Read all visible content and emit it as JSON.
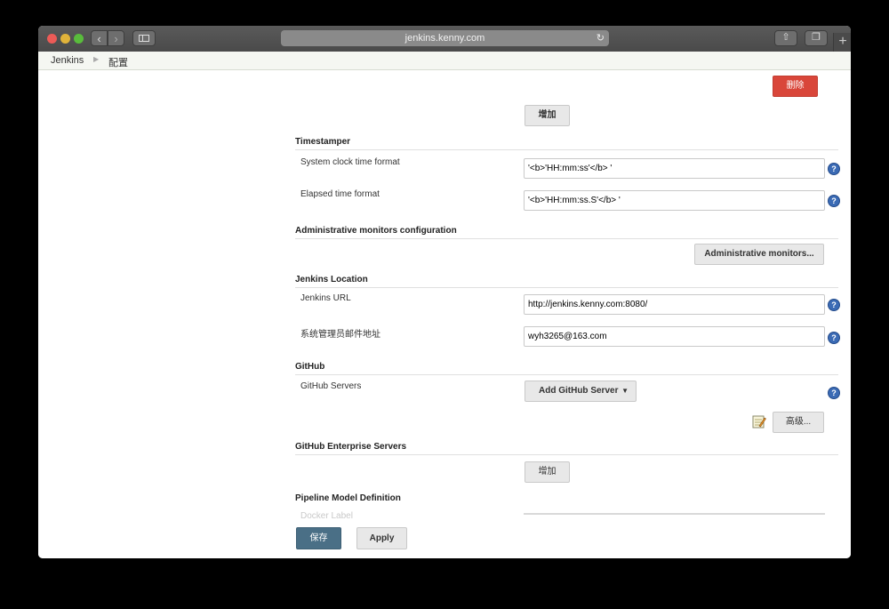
{
  "browser": {
    "url": "jenkins.kenny.com",
    "reload_icon": "reload-icon",
    "back_icon": "chevron-left-icon",
    "forward_icon": "chevron-right-icon",
    "sidebar_icon": "sidebar-icon",
    "share_icon": "share-icon",
    "tabs_icon": "tabs-icon",
    "newtab_label": "+"
  },
  "breadcrumb": {
    "items": [
      "Jenkins",
      "配置"
    ]
  },
  "buttons": {
    "delete": "删除",
    "add": "增加",
    "admin_monitors": "Administrative monitors...",
    "add_github_server": "Add GitHub Server",
    "advanced": "高级...",
    "add_enterprise": "增加",
    "save": "保存",
    "apply": "Apply"
  },
  "sections": {
    "timestamper": {
      "title": "Timestamper",
      "system_clock_label": "System clock time format",
      "system_clock_value": "'<b>'HH:mm:ss'</b> '",
      "elapsed_label": "Elapsed time format",
      "elapsed_value": "'<b>'HH:mm:ss.S'</b> '"
    },
    "admin_monitors": {
      "title": "Administrative monitors configuration"
    },
    "jenkins_location": {
      "title": "Jenkins Location",
      "url_label": "Jenkins URL",
      "url_value": "http://jenkins.kenny.com:8080/",
      "email_label": "系统管理员邮件地址",
      "email_value": "wyh3265@163.com"
    },
    "github": {
      "title": "GitHub",
      "servers_label": "GitHub Servers"
    },
    "github_enterprise": {
      "title": "GitHub Enterprise Servers"
    },
    "pipeline": {
      "title": "Pipeline Model Definition",
      "partial_label": "Docker Label"
    }
  },
  "help_glyph": "?",
  "colors": {
    "delete_button": "#d9463a",
    "save_button": "#4a6f86",
    "help_icon": "#3b6bb5"
  }
}
